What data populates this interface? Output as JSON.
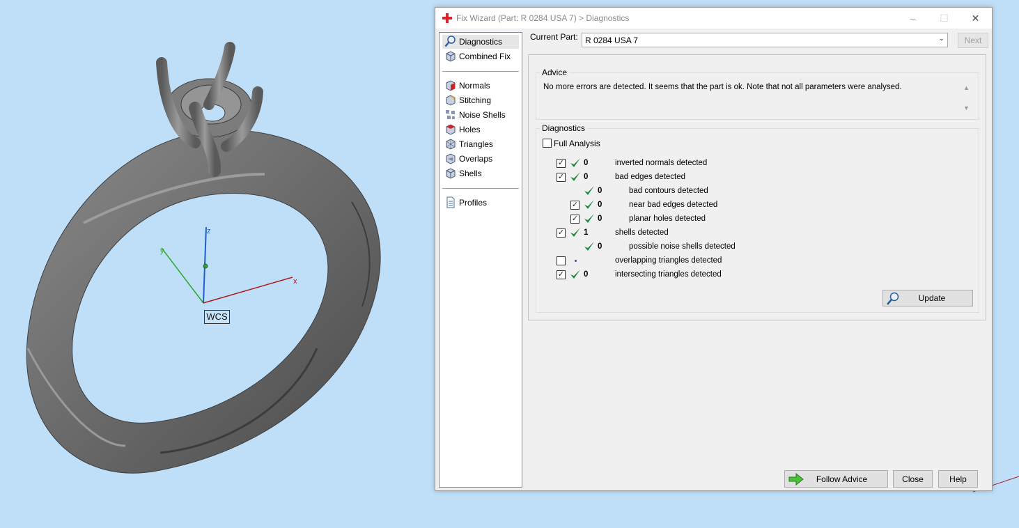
{
  "window": {
    "title": "Fix Wizard (Part: R 0284 USA 7) > Diagnostics",
    "controls": [
      "–",
      "☐",
      "✕"
    ]
  },
  "viewport": {
    "wcs_label": "WCS",
    "axes": {
      "x": "x",
      "y": "y",
      "z": "z"
    }
  },
  "nav": {
    "top": [
      {
        "label": "Diagnostics",
        "icon": "magnifier-icon",
        "selected": true
      },
      {
        "label": "Combined Fix",
        "icon": "cube-icon"
      }
    ],
    "fixes": [
      {
        "label": "Normals",
        "icon": "normals-cube-icon"
      },
      {
        "label": "Stitching",
        "icon": "stitching-cube-icon"
      },
      {
        "label": "Noise Shells",
        "icon": "noise-shells-icon"
      },
      {
        "label": "Holes",
        "icon": "holes-cube-icon"
      },
      {
        "label": "Triangles",
        "icon": "triangles-cube-icon"
      },
      {
        "label": "Overlaps",
        "icon": "overlaps-cube-icon"
      },
      {
        "label": "Shells",
        "icon": "shells-cube-icon"
      }
    ],
    "bottom": [
      {
        "label": "Profiles",
        "icon": "document-icon"
      }
    ]
  },
  "current_part": {
    "label": "Current Part:",
    "value": "R 0284 USA 7"
  },
  "next_button": "Next",
  "advice": {
    "title": "Advice",
    "text": "No more errors are detected. It seems that the part is ok. Note that not all parameters were analysed."
  },
  "diagnostics": {
    "title": "Diagnostics",
    "full_analysis_label": "Full Analysis",
    "full_analysis_checked": false,
    "rows": [
      {
        "checkbox": true,
        "status": "ok",
        "count": "0",
        "label": "inverted normals detected",
        "indent": 0
      },
      {
        "checkbox": true,
        "status": "ok",
        "count": "0",
        "label": "bad edges detected",
        "indent": 0
      },
      {
        "checkbox": null,
        "status": "ok",
        "count": "0",
        "label": "bad contours detected",
        "indent": 1
      },
      {
        "checkbox": true,
        "status": "ok",
        "count": "0",
        "label": "near bad edges detected",
        "indent": 1
      },
      {
        "checkbox": true,
        "status": "ok",
        "count": "0",
        "label": "planar holes detected",
        "indent": 1
      },
      {
        "checkbox": true,
        "status": "ok",
        "count": "1",
        "label": "shells detected",
        "indent": 0
      },
      {
        "checkbox": null,
        "status": "ok",
        "count": "0",
        "label": "possible noise shells detected",
        "indent": 1
      },
      {
        "checkbox": false,
        "status": "none",
        "count": "",
        "label": "overlapping triangles detected",
        "indent": 0
      },
      {
        "checkbox": true,
        "status": "ok",
        "count": "0",
        "label": "intersecting triangles detected",
        "indent": 0
      }
    ],
    "update_button": "Update"
  },
  "footer": {
    "follow_advice": "Follow Advice",
    "close": "Close",
    "help": "Help"
  },
  "colors": {
    "background": "#bfdff8",
    "check_green": "#1e8a3c",
    "axis_x": "#b01818",
    "axis_y": "#2aa82a",
    "axis_z": "#1f5fc4"
  }
}
